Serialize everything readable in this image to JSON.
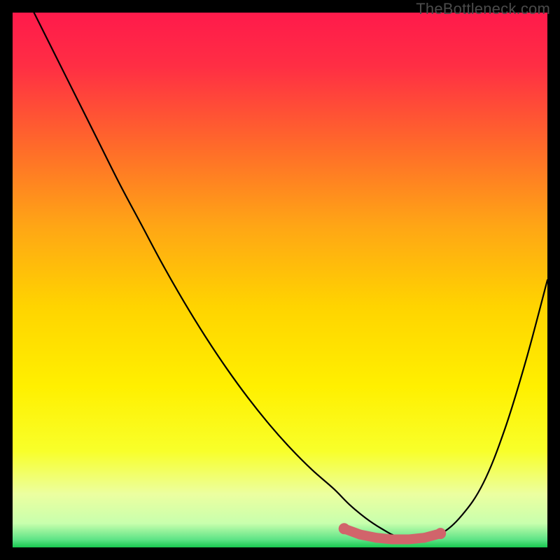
{
  "watermark": "TheBottleneck.com",
  "colors": {
    "bg": "#000000",
    "gradient_stops": [
      {
        "offset": 0.0,
        "color": "#ff1a4b"
      },
      {
        "offset": 0.1,
        "color": "#ff2e44"
      },
      {
        "offset": 0.25,
        "color": "#ff6a2a"
      },
      {
        "offset": 0.4,
        "color": "#ffa615"
      },
      {
        "offset": 0.55,
        "color": "#ffd400"
      },
      {
        "offset": 0.7,
        "color": "#fff000"
      },
      {
        "offset": 0.82,
        "color": "#f8ff2a"
      },
      {
        "offset": 0.9,
        "color": "#ecffa0"
      },
      {
        "offset": 0.955,
        "color": "#c8ffad"
      },
      {
        "offset": 0.985,
        "color": "#5fe487"
      },
      {
        "offset": 1.0,
        "color": "#18c850"
      }
    ],
    "curve": "#000000",
    "marker_fill": "#d1646b",
    "marker_stroke": "#c45860"
  },
  "chart_data": {
    "type": "line",
    "title": "",
    "xlabel": "",
    "ylabel": "",
    "xlim": [
      0,
      100
    ],
    "ylim": [
      0,
      100
    ],
    "series": [
      {
        "name": "bottleneck-curve",
        "x": [
          4,
          8,
          12,
          16,
          20,
          24,
          28,
          32,
          36,
          40,
          44,
          48,
          52,
          56,
          60,
          63,
          66,
          69,
          72,
          76,
          80,
          84,
          88,
          92,
          96,
          100
        ],
        "y": [
          100,
          92,
          84,
          76,
          68,
          60.5,
          53,
          46,
          39.5,
          33.5,
          28,
          23,
          18.5,
          14.5,
          11,
          8,
          5.5,
          3.5,
          2,
          1.4,
          2.5,
          6,
          12,
          22,
          35,
          50
        ]
      }
    ],
    "markers": {
      "name": "optimal-range",
      "x": [
        62,
        65,
        68,
        71,
        74,
        77,
        80
      ],
      "y": [
        3.5,
        2.4,
        1.8,
        1.5,
        1.5,
        1.8,
        2.6
      ]
    }
  }
}
